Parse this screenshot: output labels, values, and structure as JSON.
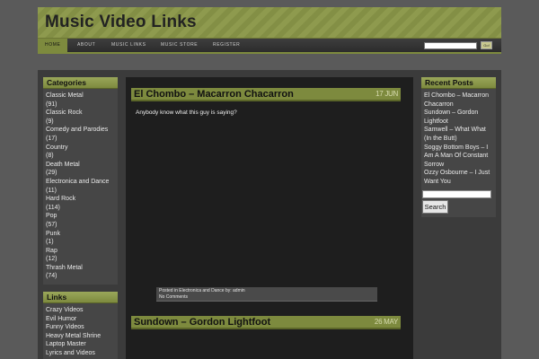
{
  "header": {
    "site_title": "Music Video Links"
  },
  "nav": {
    "items": [
      "HOME",
      "ABOUT",
      "MUSIC LINKS",
      "MUSIC STORE",
      "REGISTER"
    ],
    "search_button": "Go!"
  },
  "left_sidebar": {
    "categories_title": "Categories",
    "categories": [
      {
        "name": "Classic Metal",
        "count": "(91)"
      },
      {
        "name": "Classic Rock",
        "count": "(9)"
      },
      {
        "name": "Comedy and Parodies",
        "count": "(17)"
      },
      {
        "name": "Country",
        "count": "(8)"
      },
      {
        "name": "Death Metal",
        "count": "(29)"
      },
      {
        "name": "Electronica and Dance",
        "count": "(11)"
      },
      {
        "name": "Hard Rock",
        "count": "(114)"
      },
      {
        "name": "Pop",
        "count": "(57)"
      },
      {
        "name": "Punk",
        "count": "(1)"
      },
      {
        "name": "Rap",
        "count": "(12)"
      },
      {
        "name": "Thrash Metal",
        "count": "(74)"
      }
    ],
    "links_title": "Links",
    "links": [
      "Crazy Videos",
      "Evil Humor",
      "Funny Videos",
      "Heavy Metal Shrine",
      "Laptop Master",
      "Lyrics and Videos"
    ]
  },
  "posts": [
    {
      "title": "El Chombo – Macarron Chacarron",
      "date": "17 JUN",
      "body": "Anybody know what this guy is saying?",
      "meta_posted": "Posted in",
      "meta_category": "Electronica and Dance",
      "meta_by": "by:",
      "meta_author": "admin",
      "meta_comments": "No Comments"
    },
    {
      "title": "Sundown – Gordon Lightfoot",
      "date": "26 MAY"
    }
  ],
  "right_sidebar": {
    "recent_title": "Recent Posts",
    "recent_posts": [
      "El Chombo – Macarron Chacarron",
      "Sundown – Gordon Lightfoot",
      "Samwell – What What (In the Butt)",
      "Soggy Bottom Boys – I Am A Man Of Constant Sorrow",
      "Ozzy Osbourne – I Just Want You"
    ],
    "search_button": "Search"
  }
}
